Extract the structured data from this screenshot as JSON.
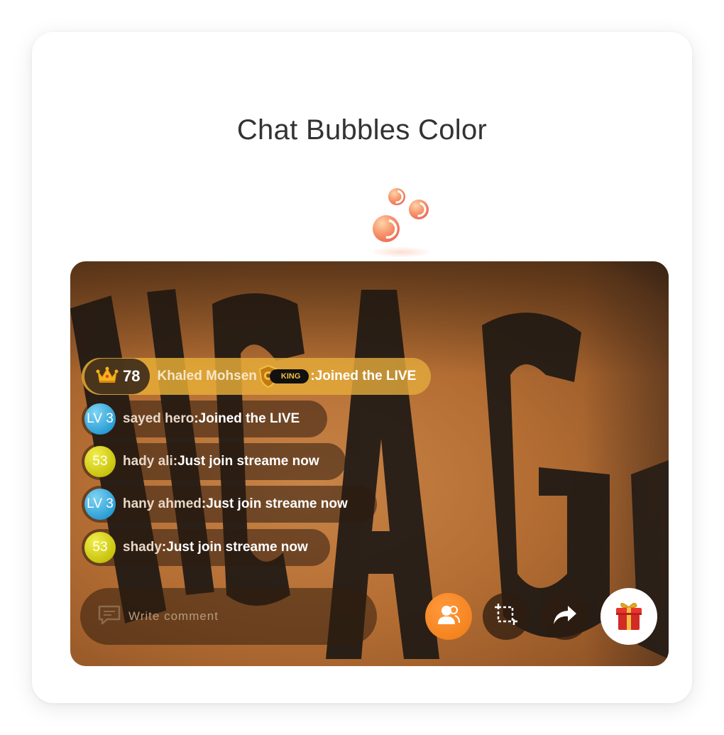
{
  "page": {
    "title": "Chat Bubbles Color"
  },
  "chat": {
    "messages": [
      {
        "type": "vip",
        "rank": "78",
        "user": "Khaled Mohsen",
        "badge_text": "KING",
        "text": ":Joined the LIVE"
      },
      {
        "type": "level",
        "level": "LV 3",
        "level_color": "#2c9fd6",
        "user": "sayed hero",
        "text": ":Joined the LIVE"
      },
      {
        "type": "level",
        "level": "53",
        "level_color": "#c9c40f",
        "user": "hady ali:",
        "text": "Just join streame now"
      },
      {
        "type": "level",
        "level": "LV 3",
        "level_color": "#2c9fd6",
        "user": "hany ahmed",
        "text": ":Just join streame now"
      },
      {
        "type": "level",
        "level": "53",
        "level_color": "#c9c40f",
        "user": "shady",
        "text": ":Just join streame now"
      }
    ]
  },
  "comment": {
    "placeholder": "Write comment",
    "icon": "comment-icon"
  },
  "actions": [
    {
      "icon": "users-icon",
      "color": "#f07a14"
    },
    {
      "icon": "crop-icon"
    },
    {
      "icon": "share-arrow-icon"
    },
    {
      "icon": "gift-icon"
    }
  ],
  "colors": {
    "accent": "#f07a14",
    "vip_bubble": "#e8ae34",
    "bubble_dark": "#2d1c10"
  }
}
